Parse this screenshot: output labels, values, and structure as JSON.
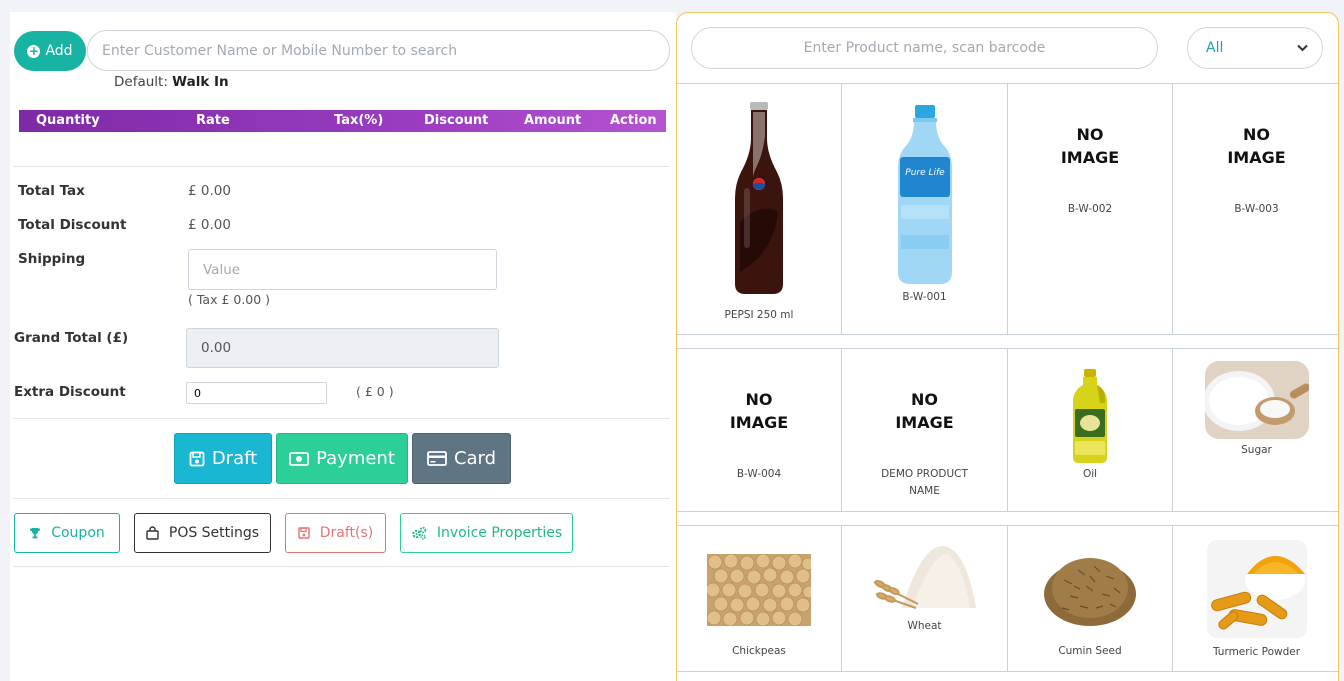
{
  "customer": {
    "add_label": "Add",
    "search_placeholder": "Enter Customer Name or Mobile Number to search",
    "default_prefix": "Default:",
    "default_value": "Walk In"
  },
  "table_headers": [
    "Quantity",
    "Rate",
    "Tax(%)",
    "Discount",
    "Amount",
    "Action"
  ],
  "totals": {
    "total_tax_label": "Total Tax",
    "total_tax_value": "£ 0.00",
    "total_discount_label": "Total Discount",
    "total_discount_value": "£ 0.00",
    "shipping_label": "Shipping",
    "shipping_placeholder": "Value",
    "shipping_tax": "( Tax £ 0.00 )",
    "grand_total_label": "Grand Total (£)",
    "grand_total_value": "0.00",
    "extra_discount_label": "Extra Discount",
    "extra_discount_value": "0",
    "extra_discount_amount": "( £ 0 )"
  },
  "actions": {
    "draft": "Draft",
    "payment": "Payment",
    "card": "Card"
  },
  "options": {
    "coupon": "Coupon",
    "pos_settings": "POS Settings",
    "drafts": "Draft(s)",
    "invoice_properties": "Invoice Properties"
  },
  "product_search": {
    "placeholder": "Enter Product name, scan barcode",
    "category_selected": "All"
  },
  "no_image_text": [
    "NO",
    "IMAGE"
  ],
  "products": [
    {
      "name": "PEPSI 250 ml",
      "image": "pepsi-bottle"
    },
    {
      "name": "B-W-001",
      "image": "water-bottle"
    },
    {
      "name": "B-W-002",
      "image": "none"
    },
    {
      "name": "B-W-003",
      "image": "none"
    },
    {
      "name": "B-W-004",
      "image": "none"
    },
    {
      "name": "DEMO PRODUCT NAME",
      "image": "none"
    },
    {
      "name": "Oil",
      "image": "oil-bottle"
    },
    {
      "name": "Sugar",
      "image": "sugar-bowl"
    },
    {
      "name": "Chickpeas",
      "image": "chickpeas"
    },
    {
      "name": "Wheat",
      "image": "wheat-flour"
    },
    {
      "name": "Cumin Seed",
      "image": "cumin-seeds"
    },
    {
      "name": "Turmeric Powder",
      "image": "turmeric"
    }
  ],
  "colors": {
    "teal": "#17b3a3",
    "purple": "#8e35b8",
    "cyan": "#19b7d2",
    "green": "#2ccf97",
    "slate": "#5f7583",
    "red": "#e57373",
    "border_accent": "#f3c75d"
  }
}
